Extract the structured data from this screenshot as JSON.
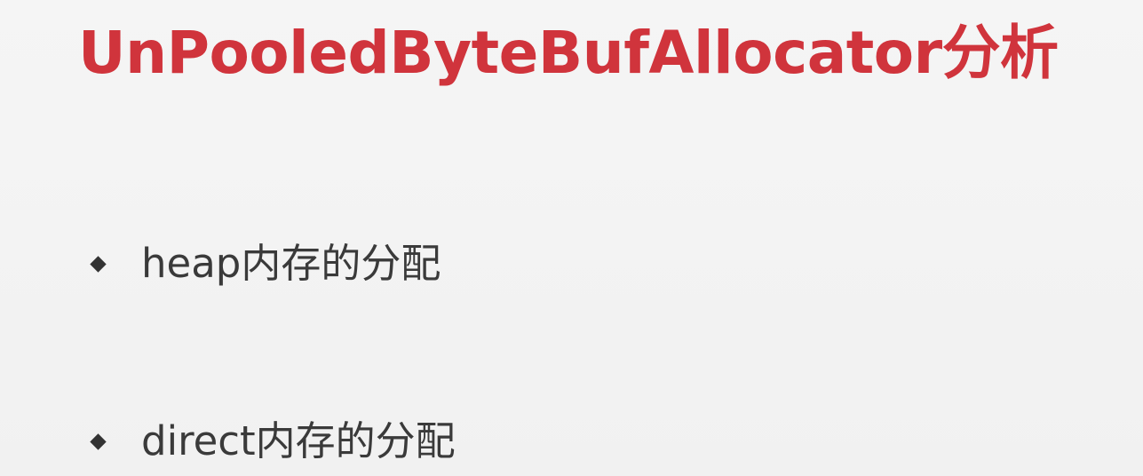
{
  "slide": {
    "title": "UnPooledByteBufAllocator分析",
    "bullets": [
      {
        "text": "heap内存的分配"
      },
      {
        "text": "direct内存的分配"
      }
    ]
  },
  "colors": {
    "title": "#d0343c",
    "text": "#3a3a3a",
    "bullet": "#333333",
    "background": "#f3f3f3"
  }
}
